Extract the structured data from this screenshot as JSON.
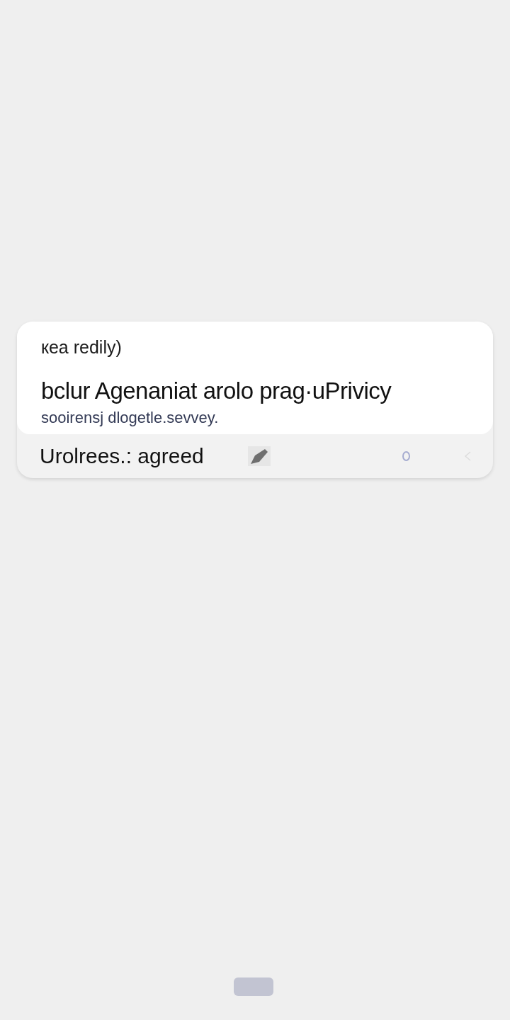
{
  "card": {
    "eyebrow": "кea redily)",
    "title": "bclur Agenaniat arolo  prag·uPrivicy",
    "subtitle": "sooirensj dlogetle.sevvey."
  },
  "footer_row": {
    "label": "Urolrees.: agreed"
  }
}
